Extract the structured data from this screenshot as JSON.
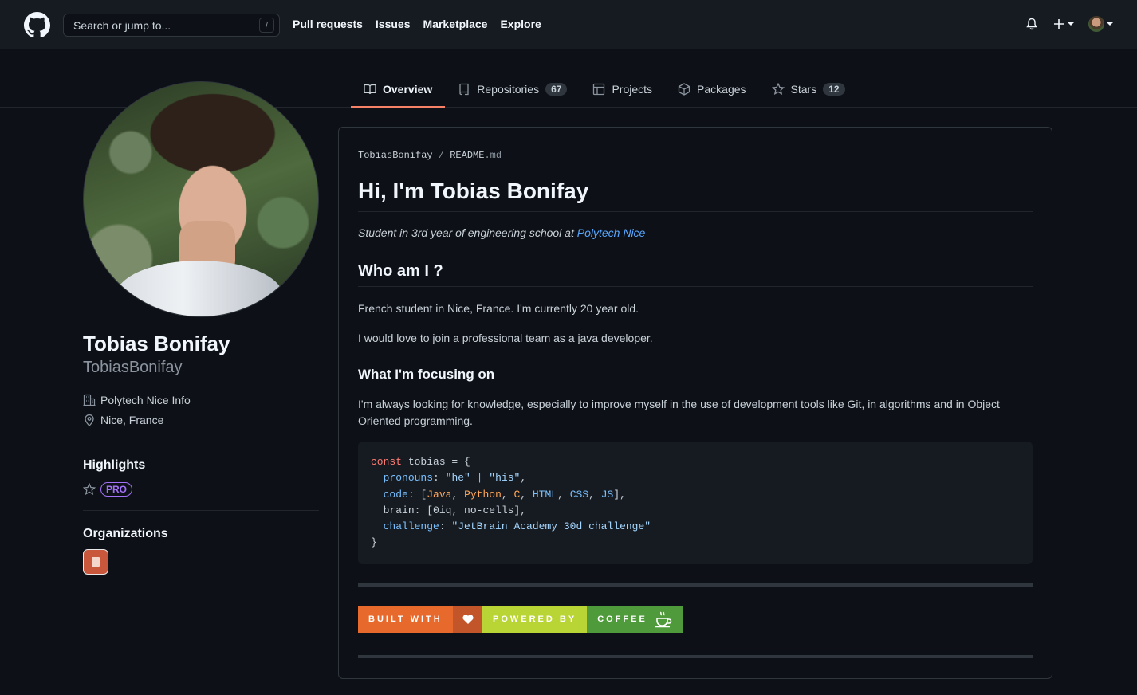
{
  "header": {
    "search_placeholder": "Search or jump to...",
    "search_shortcut": "/",
    "nav": [
      "Pull requests",
      "Issues",
      "Marketplace",
      "Explore"
    ]
  },
  "tabs": [
    {
      "label": "Overview",
      "icon": "book-icon",
      "active": true
    },
    {
      "label": "Repositories",
      "icon": "repo-icon",
      "count": "67"
    },
    {
      "label": "Projects",
      "icon": "project-icon"
    },
    {
      "label": "Packages",
      "icon": "package-icon"
    },
    {
      "label": "Stars",
      "icon": "star-icon",
      "count": "12"
    }
  ],
  "profile": {
    "name": "Tobias Bonifay",
    "login": "TobiasBonifay",
    "company": "Polytech Nice Info",
    "location": "Nice, France",
    "highlights_title": "Highlights",
    "pro_label": "PRO",
    "organizations_title": "Organizations"
  },
  "readme": {
    "crumb_user": "TobiasBonifay",
    "crumb_sep": "/",
    "crumb_file": "README",
    "crumb_ext": ".md",
    "title": "Hi, I'm Tobias Bonifay",
    "subtitle_text": "Student in 3rd year of engineering school at ",
    "subtitle_link": "Polytech Nice",
    "who_title": "Who am I ?",
    "who_p1": "French student in Nice, France. I'm currently 20 year old.",
    "who_p2": "I would love to join a professional team as a java developer.",
    "focus_title": "What I'm focusing on",
    "focus_p": "I'm always looking for knowledge, especially to improve myself in the use of development tools like Git, in algorithms and in Object Oriented programming.",
    "code": {
      "l1_kw": "const",
      "l1_rest": " tobias = {",
      "l2_prop": "pronouns",
      "l2_a": "\"he\"",
      "l2_b": "\"his\"",
      "l3_prop": "code",
      "l3_items": [
        "Java",
        "Python",
        "C",
        "HTML",
        "CSS",
        "JS"
      ],
      "l4_prop": "brain",
      "l4_val": "[0iq, no-cells],",
      "l5_prop": "challenge",
      "l5_val": "\"JetBrain Academy 30d challenge\"",
      "l6": "}"
    },
    "badge1_left": "BUILT WITH",
    "badge2_left": "POWERED BY",
    "badge2_right": "COFFEE",
    "colors": {
      "badge1_left": "#e8692c",
      "badge1_right": "#c2552a",
      "badge2_left": "#b9d535",
      "badge2_right": "#4f9a3a"
    }
  }
}
